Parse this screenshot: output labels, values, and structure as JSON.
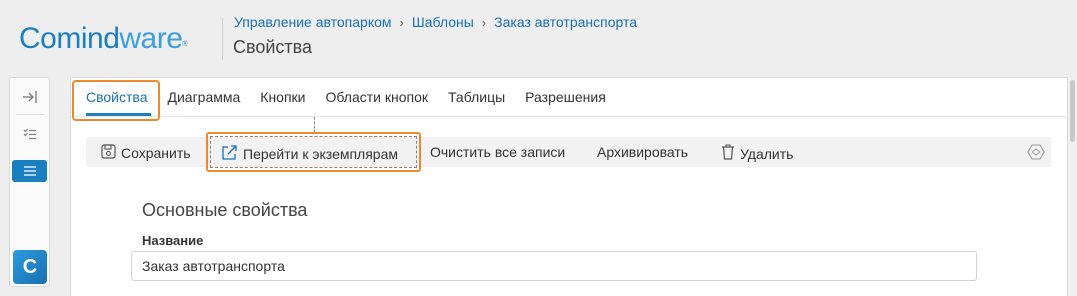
{
  "logo": {
    "part1": "Comind",
    "part2": "ware",
    "mark": "®"
  },
  "breadcrumb": {
    "items": [
      "Управление автопарком",
      "Шаблоны",
      "Заказ автотранспорта"
    ],
    "separator": "›"
  },
  "page_title": "Свойства",
  "left_bar": {
    "icons": [
      "expand-icon",
      "checklist-icon",
      "list-icon"
    ],
    "logo_letter": "C"
  },
  "tabs": [
    "Свойства",
    "Диаграмма",
    "Кнопки",
    "Области кнопок",
    "Таблицы",
    "Разрешения"
  ],
  "toolbar": {
    "save": "Сохранить",
    "goto_instances": "Перейти к экземплярам",
    "clear_all": "Очистить все записи",
    "archive": "Архивировать",
    "delete": "Удалить"
  },
  "section_title": "Основные свойства",
  "name_field": {
    "label": "Название",
    "value": "Заказ автотранспорта"
  },
  "colors": {
    "accent": "#1a7fc1",
    "highlight": "#ef8a2c"
  }
}
